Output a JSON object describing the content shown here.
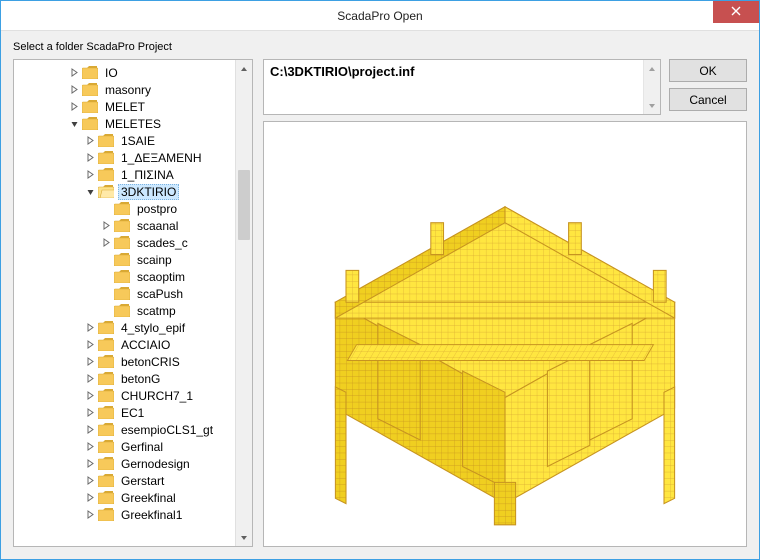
{
  "window": {
    "title": "ScadaPro Open"
  },
  "prompt": "Select a folder ScadaPro Project",
  "path": "C:\\3DKTIRIO\\project.inf",
  "buttons": {
    "ok": "OK",
    "cancel": "Cancel"
  },
  "tree": [
    {
      "depth": 3,
      "exp": "closed",
      "label": "IO"
    },
    {
      "depth": 3,
      "exp": "closed",
      "label": "masonry"
    },
    {
      "depth": 3,
      "exp": "closed",
      "label": "MELET"
    },
    {
      "depth": 3,
      "exp": "open",
      "label": "MELETES"
    },
    {
      "depth": 4,
      "exp": "closed",
      "label": "1SAIE"
    },
    {
      "depth": 4,
      "exp": "closed",
      "label": "1_ΔΕΞΑΜΕΝΗ"
    },
    {
      "depth": 4,
      "exp": "closed",
      "label": "1_ΠΙΣΙΝΑ"
    },
    {
      "depth": 4,
      "exp": "open",
      "label": "3DKTIRIO",
      "selected": true,
      "open": true
    },
    {
      "depth": 5,
      "exp": "none",
      "label": "postpro"
    },
    {
      "depth": 5,
      "exp": "closed",
      "label": "scaanal"
    },
    {
      "depth": 5,
      "exp": "closed",
      "label": "scades_c"
    },
    {
      "depth": 5,
      "exp": "none",
      "label": "scainp"
    },
    {
      "depth": 5,
      "exp": "none",
      "label": "scaoptim"
    },
    {
      "depth": 5,
      "exp": "none",
      "label": "scaPush"
    },
    {
      "depth": 5,
      "exp": "none",
      "label": "scatmp"
    },
    {
      "depth": 4,
      "exp": "closed",
      "label": "4_stylo_epif"
    },
    {
      "depth": 4,
      "exp": "closed",
      "label": "ACCIAIO"
    },
    {
      "depth": 4,
      "exp": "closed",
      "label": "betonCRIS"
    },
    {
      "depth": 4,
      "exp": "closed",
      "label": "betonG"
    },
    {
      "depth": 4,
      "exp": "closed",
      "label": "CHURCH7_1"
    },
    {
      "depth": 4,
      "exp": "closed",
      "label": "EC1"
    },
    {
      "depth": 4,
      "exp": "closed",
      "label": "esempioCLS1_gt"
    },
    {
      "depth": 4,
      "exp": "closed",
      "label": "Gerfinal"
    },
    {
      "depth": 4,
      "exp": "closed",
      "label": "Gernodesign"
    },
    {
      "depth": 4,
      "exp": "closed",
      "label": "Gerstart"
    },
    {
      "depth": 4,
      "exp": "closed",
      "label": "Greekfinal"
    },
    {
      "depth": 4,
      "exp": "closed",
      "label": "Greekfinal1"
    }
  ],
  "colors": {
    "accent": "#3da0e3",
    "close": "#c75050",
    "select": "#cce8ff",
    "folder": "#f7c95a",
    "folderDark": "#d9a934"
  }
}
